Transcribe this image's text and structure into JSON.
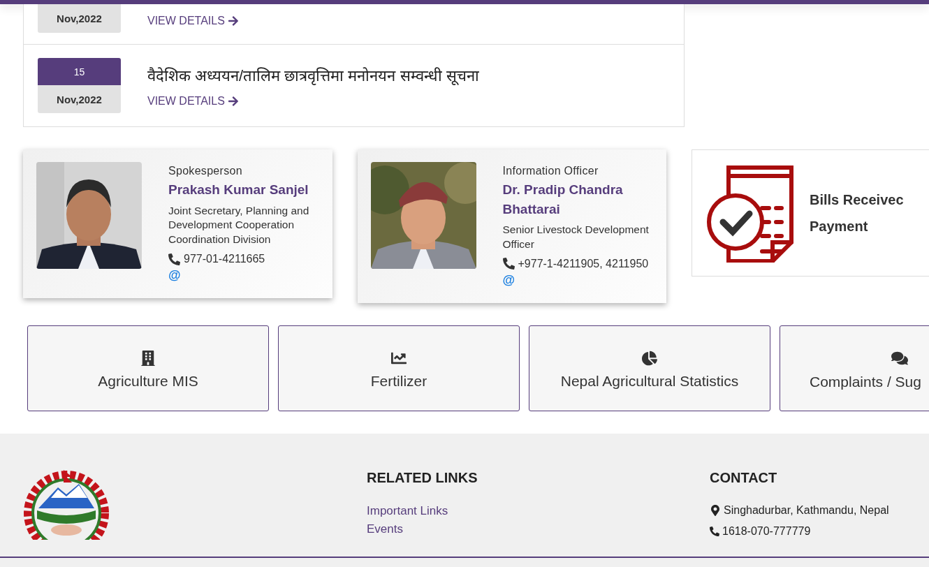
{
  "notices": [
    {
      "month": "Nov,2022",
      "link": "VIEW DETAILS"
    },
    {
      "day": "15",
      "month": "Nov,2022",
      "title": "वैदेशिक अध्ययन/तालिम छात्रवृत्तिमा मनोनयन सम्वन्धी सूचना",
      "link": "VIEW DETAILS"
    }
  ],
  "officers": [
    {
      "role": "Spokesperson",
      "name": "Prakash Kumar Sanjel",
      "position": "Joint Secretary, Planning and Development Cooperation Coordination Division",
      "phone": "977-01-4211665",
      "email": "@"
    },
    {
      "role": "Information Officer",
      "name": "Dr. Pradip Chandra Bhattarai",
      "position": "Senior Livestock Development Officer",
      "phone": "+977-1-4211905, 4211950",
      "email": "@"
    }
  ],
  "bills": {
    "lines": [
      "Bills Receivec",
      "Payment"
    ]
  },
  "tiles": [
    {
      "kind": "building",
      "label": "Agriculture MIS"
    },
    {
      "kind": "chart",
      "label": "Fertilizer"
    },
    {
      "kind": "pie",
      "label": "Nepal Agricultural Statistics"
    },
    {
      "kind": "comments",
      "label": "Complaints / Sug"
    }
  ],
  "footer": {
    "related_links": {
      "heading": "RELATED LINKS",
      "items": [
        "Important Links",
        "Events"
      ]
    },
    "contact": {
      "heading": "CONTACT",
      "address": "Singhadurbar, Kathmandu, Nepal",
      "phone": "1618-070-777779"
    }
  }
}
